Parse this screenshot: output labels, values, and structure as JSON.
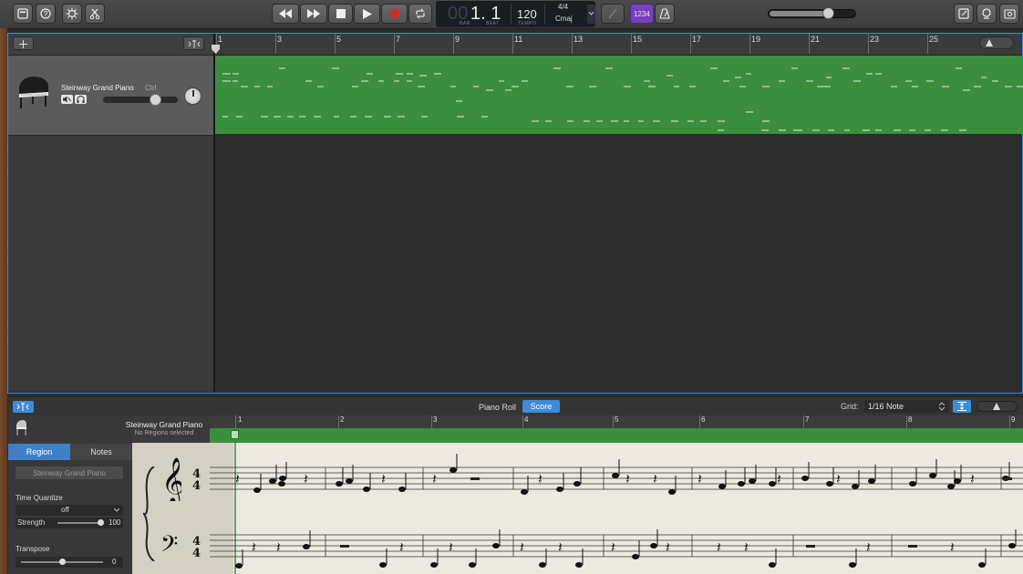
{
  "toolbar": {
    "lcd": {
      "bar_prefix": "00",
      "position": "1. 1",
      "bar_label": "BAR",
      "beat_label": "BEAT",
      "tempo": "120",
      "tempo_label": "TEMPO",
      "time_signature": "4/4",
      "key": "Cmaj"
    },
    "count_in": "1234"
  },
  "ruler": {
    "bars": [
      "1",
      "3",
      "5",
      "7",
      "9",
      "11",
      "13",
      "15",
      "17",
      "19",
      "21",
      "23",
      "25"
    ]
  },
  "track": {
    "name": "Steinway Grand Piano",
    "ctrl_suffix": "Ctrl"
  },
  "editor": {
    "tabs": [
      "Piano Roll",
      "Score"
    ],
    "grid_label": "Grid:",
    "grid_value": "1/16 Note",
    "header_track": "Steinway Grand Piano",
    "header_sub": "No Regions selected",
    "bars": [
      "1",
      "2",
      "3",
      "4",
      "5",
      "6",
      "7",
      "8",
      "9"
    ]
  },
  "inspector": {
    "tabs": [
      "Region",
      "Notes"
    ],
    "region_name": "Steinway Grand Piano",
    "time_quantize_label": "Time Quantize",
    "time_quantize_value": "off",
    "strength_label": "Strength",
    "strength_value": "100",
    "transpose_label": "Transpose",
    "transpose_value": "0"
  },
  "colors": {
    "accent": "#3f8bd8",
    "region_green": "#3b8e3d",
    "record_red": "#c8312b",
    "count_in_purple": "#7a3fbf"
  }
}
